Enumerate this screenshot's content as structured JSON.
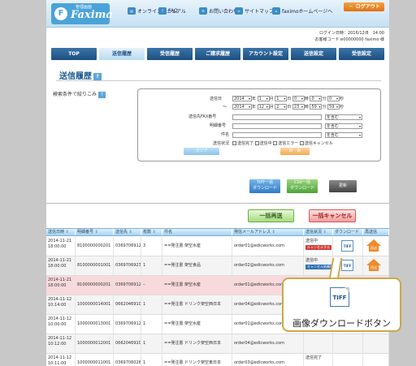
{
  "header": {
    "logo_sub": "管理画面",
    "logo_brand": "Faxima",
    "logo_mark": "F",
    "nav": [
      {
        "icon": "book-icon",
        "label": "オンラインマニュアル"
      },
      {
        "icon": "faq-icon",
        "label": "FAQ"
      },
      {
        "icon": "mail-icon",
        "label": "お問い合わせ"
      },
      {
        "icon": "sitemap-icon",
        "label": "サイトマップ"
      },
      {
        "icon": "home-icon",
        "label": "faximoホームページへ"
      }
    ],
    "logout": "ログアウト",
    "login_datetime": "ログイン日時：2016/12/8　14:00",
    "customer": "お客様コード:e00000000 faximo 様"
  },
  "tabs": [
    {
      "label": "TOP",
      "active": false
    },
    {
      "label": "送信履歴",
      "active": true
    },
    {
      "label": "受信履歴",
      "active": false
    },
    {
      "label": "ご請求履歴",
      "active": false
    },
    {
      "label": "アカウント設定",
      "active": false
    },
    {
      "label": "送信設定",
      "active": false
    },
    {
      "label": "受信設定",
      "active": false
    }
  ],
  "page": {
    "title": "送信履歴",
    "help_icon": "?",
    "filter_label": "検索条件で絞りこみ"
  },
  "filter": {
    "send_date_label": "送信日",
    "from": {
      "year": "2014",
      "month": "1",
      "day": "1",
      "hour": "0",
      "min": "0",
      "sec": "0"
    },
    "to": {
      "year": "2014",
      "month": "12",
      "day": "2",
      "hour": "23",
      "min": "59",
      "sec": "59"
    },
    "range_sep": "～",
    "unit_year": "年",
    "unit_month": "月",
    "unit_day": "日",
    "unit_hour": "時",
    "unit_min": "分",
    "unit_sec": "秒",
    "fax_label": "送信先FAX番号",
    "detail_label": "明細番号",
    "subject_label": "件名",
    "contains": "を含む",
    "status_label": "送信状況",
    "statuses": [
      "送信完了",
      "送信中",
      "送信エラー",
      "送信キャンセル"
    ],
    "clear_button": "クリア",
    "search_button": "検　索"
  },
  "actions": {
    "tiff_bulk_line1": "TIFF一括",
    "tiff_bulk_line2": "ダウンロード",
    "csv_bulk_line1": "CSV一括",
    "csv_bulk_line2": "ダウンロード",
    "update": "更新",
    "bulk_resend": "一括再送",
    "bulk_cancel": "一括キャンセル"
  },
  "table": {
    "headers": [
      "送信日時",
      "明細番号",
      "送信先",
      "枚数",
      "件名",
      "発信メールアドレス",
      "送信状況",
      "ダウンロード",
      "再送信"
    ],
    "rows": [
      {
        "date": "2014-11-21",
        "time": "18:00:00",
        "id": "8100000000201",
        "dest": "0369706912",
        "pages": "3",
        "subject": "==発注書 架空水産",
        "email": "order01@edicworks.com",
        "status": "送信中",
        "badge": "キャンセルする",
        "badge_type": "red",
        "tiff": true,
        "resend": true,
        "error": false
      },
      {
        "date": "2014-11-21",
        "time": "18:00:00",
        "id": "8100000001001",
        "dest": "0369706923",
        "pages": "1",
        "subject": "==発注書 架空食品",
        "email": "order02@edicworks.com",
        "status": "送信中",
        "badge": "キャンセル依頼中",
        "badge_type": "blue",
        "tiff": true,
        "resend": true,
        "error": false
      },
      {
        "date": "2014-11-21",
        "time": "18:00:00",
        "id": "8100000000201",
        "dest": "0369706912",
        "pages": "–",
        "subject": "==発注書 架空水産",
        "email": "order01@edicworks.com",
        "status": "",
        "badge": "",
        "badge_type": "",
        "tiff": false,
        "resend": false,
        "error": true
      },
      {
        "date": "2014-11-12",
        "time": "10:14:00",
        "id": "1000000014001",
        "dest": "0662046910",
        "pages": "1",
        "subject": "==発注書 ドリンク架空西日本",
        "email": "order04@edicworks.com",
        "status": "",
        "badge": "",
        "badge_type": "",
        "tiff": false,
        "resend": false,
        "error": false
      },
      {
        "date": "2014-11-12",
        "time": "10:00:00",
        "id": "1000000013001",
        "dest": "0369706912",
        "pages": "1",
        "subject": "==発注書 架空水産",
        "email": "order01@edicworks.com",
        "status": "",
        "badge": "",
        "badge_type": "",
        "tiff": false,
        "resend": false,
        "error": false
      },
      {
        "date": "2014-11-12",
        "time": "10:12:00",
        "id": "1000000012001",
        "dest": "0662046910",
        "pages": "1",
        "subject": "==発注書 ドリンク架空西日本",
        "email": "order04@edicworks.com",
        "status": "",
        "badge": "",
        "badge_type": "",
        "tiff": false,
        "resend": false,
        "error": false
      },
      {
        "date": "2014-11-12",
        "time": "10:11:00",
        "id": "1000000011001",
        "dest": "0369706026",
        "pages": "1",
        "subject": "==発注書 ドリンク架空東日本",
        "email": "order03@edicworks.com",
        "status": "送信完了",
        "badge": "",
        "badge_type": "",
        "tiff": false,
        "resend": false,
        "error": false
      }
    ]
  },
  "callout": {
    "icon_text": "TIFF",
    "text": "画像ダウンロードボタン"
  }
}
